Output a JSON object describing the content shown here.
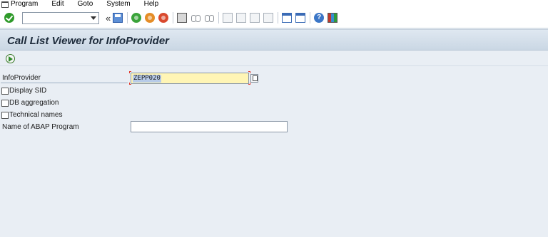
{
  "menubar": {
    "items": [
      "Program",
      "Edit",
      "Goto",
      "System",
      "Help"
    ]
  },
  "toolbar": {
    "back_arrows": "«",
    "command_field_value": ""
  },
  "title": {
    "text": "Call List Viewer for InfoProvider"
  },
  "form": {
    "infoprovider_label": "InfoProvider",
    "infoprovider_value": "ZEPP020",
    "display_sid_label": "Display SID",
    "db_aggregation_label": "DB aggregation",
    "technical_names_label": "Technical names",
    "abap_program_label": "Name of ABAP Program",
    "abap_program_value": ""
  },
  "colors": {
    "title_bg": "#cad7e4",
    "required_field_bg": "#fff5b5",
    "selection_highlight": "#b7cbe8"
  }
}
